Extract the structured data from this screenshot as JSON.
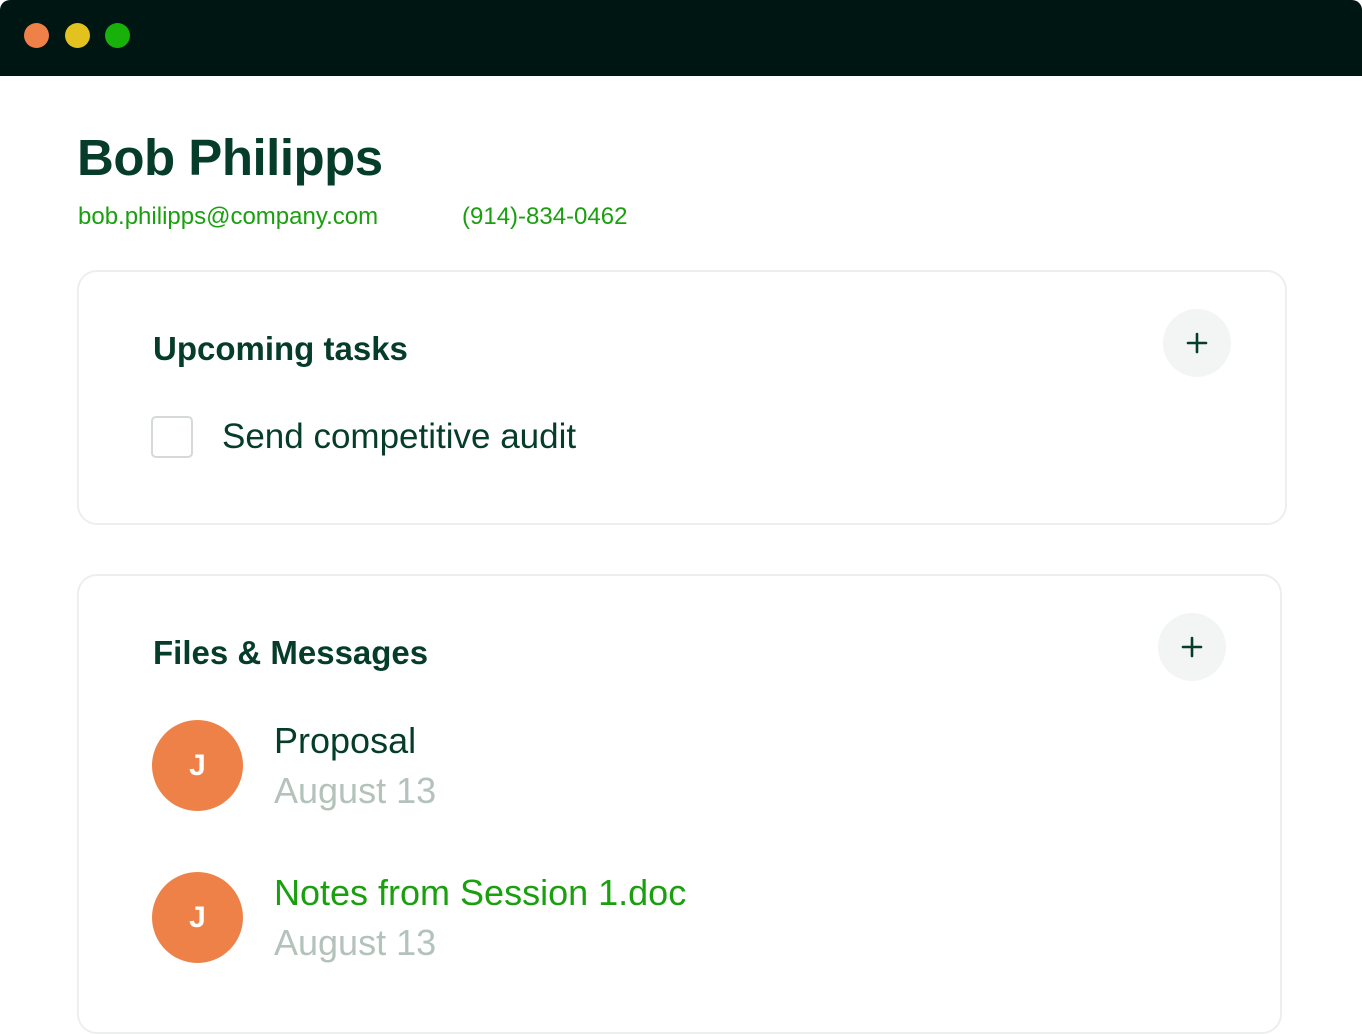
{
  "window": {
    "controls": [
      "close",
      "minimize",
      "maximize"
    ]
  },
  "contact": {
    "name": "Bob Philipps",
    "email": "bob.philipps@company.com",
    "phone": "(914)-834-0462"
  },
  "tasks_card": {
    "title": "Upcoming tasks",
    "add_icon": "plus-icon",
    "items": [
      {
        "label": "Send competitive audit",
        "checked": false
      }
    ]
  },
  "files_card": {
    "title": "Files & Messages",
    "add_icon": "plus-icon",
    "items": [
      {
        "avatar_initial": "J",
        "name": "Proposal",
        "date": "August 13"
      },
      {
        "avatar_initial": "J",
        "name": "Notes from Session 1.doc",
        "date": "August 13"
      }
    ]
  },
  "colors": {
    "titlebar": "#001612",
    "dot_close": "#ef8048",
    "dot_minimize": "#e2c21f",
    "dot_maximize": "#17b10a",
    "heading": "#063c2a",
    "accent_green": "#1aa00f",
    "avatar": "#ee8147",
    "muted": "#b3c2bb"
  }
}
